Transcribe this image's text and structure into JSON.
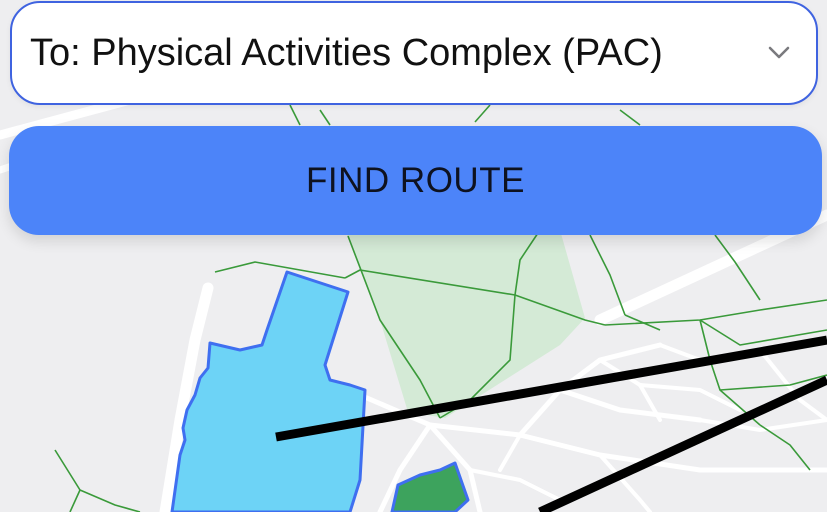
{
  "destination_select": {
    "value": "To: Physical Activities Complex (PAC)",
    "icon": "chevron-down-icon"
  },
  "find_route_button": {
    "label": "FIND ROUTE"
  },
  "map": {
    "colors": {
      "background": "#eeeef0",
      "roads": "#ffffff",
      "paths": "#3a9a3a",
      "park": "#d4ead6",
      "selected_building_fill": "#6dd3f6",
      "selected_building_outline": "#3f6ff0",
      "destination_building_fill": "#3da35d",
      "route_lines": "#000000"
    }
  }
}
